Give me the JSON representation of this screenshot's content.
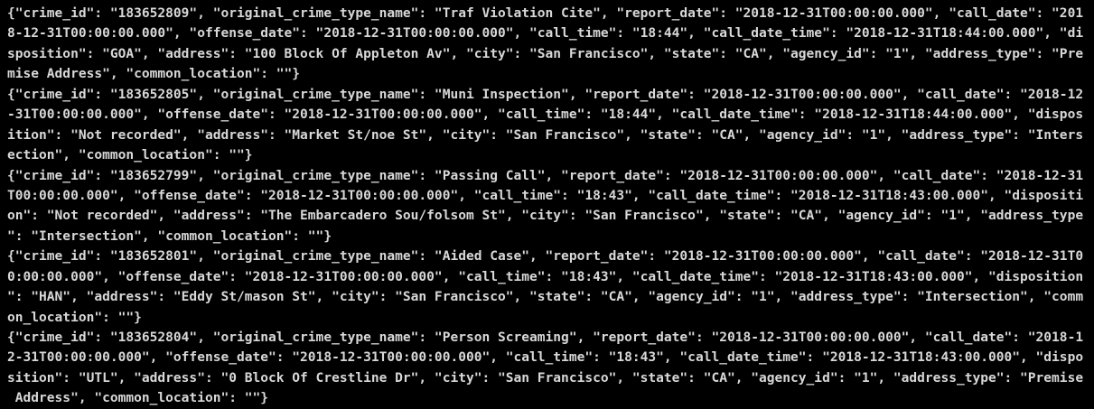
{
  "terminal": {
    "lines": [
      "{\"crime_id\": \"183652809\", \"original_crime_type_name\": \"Traf Violation Cite\", \"report_date\": \"2018-12-31T00:00:00.000\", \"call_date\": \"201",
      "8-12-31T00:00:00.000\", \"offense_date\": \"2018-12-31T00:00:00.000\", \"call_time\": \"18:44\", \"call_date_time\": \"2018-12-31T18:44:00.000\", \"di",
      "sposition\": \"GOA\", \"address\": \"100 Block Of Appleton Av\", \"city\": \"San Francisco\", \"state\": \"CA\", \"agency_id\": \"1\", \"address_type\": \"Pre",
      "mise Address\", \"common_location\": \"\"}",
      "{\"crime_id\": \"183652805\", \"original_crime_type_name\": \"Muni Inspection\", \"report_date\": \"2018-12-31T00:00:00.000\", \"call_date\": \"2018-12",
      "-31T00:00:00.000\", \"offense_date\": \"2018-12-31T00:00:00.000\", \"call_time\": \"18:44\", \"call_date_time\": \"2018-12-31T18:44:00.000\", \"dispos",
      "ition\": \"Not recorded\", \"address\": \"Market St/noe St\", \"city\": \"San Francisco\", \"state\": \"CA\", \"agency_id\": \"1\", \"address_type\": \"Inters",
      "ection\", \"common_location\": \"\"}",
      "{\"crime_id\": \"183652799\", \"original_crime_type_name\": \"Passing Call\", \"report_date\": \"2018-12-31T00:00:00.000\", \"call_date\": \"2018-12-31",
      "T00:00:00.000\", \"offense_date\": \"2018-12-31T00:00:00.000\", \"call_time\": \"18:43\", \"call_date_time\": \"2018-12-31T18:43:00.000\", \"dispositi",
      "on\": \"Not recorded\", \"address\": \"The Embarcadero Sou/folsom St\", \"city\": \"San Francisco\", \"state\": \"CA\", \"agency_id\": \"1\", \"address_type",
      "\": \"Intersection\", \"common_location\": \"\"}",
      "{\"crime_id\": \"183652801\", \"original_crime_type_name\": \"Aided Case\", \"report_date\": \"2018-12-31T00:00:00.000\", \"call_date\": \"2018-12-31T0",
      "0:00:00.000\", \"offense_date\": \"2018-12-31T00:00:00.000\", \"call_time\": \"18:43\", \"call_date_time\": \"2018-12-31T18:43:00.000\", \"disposition",
      "\": \"HAN\", \"address\": \"Eddy St/mason St\", \"city\": \"San Francisco\", \"state\": \"CA\", \"agency_id\": \"1\", \"address_type\": \"Intersection\", \"comm",
      "on_location\": \"\"}",
      "{\"crime_id\": \"183652804\", \"original_crime_type_name\": \"Person Screaming\", \"report_date\": \"2018-12-31T00:00:00.000\", \"call_date\": \"2018-1",
      "2-31T00:00:00.000\", \"offense_date\": \"2018-12-31T00:00:00.000\", \"call_time\": \"18:43\", \"call_date_time\": \"2018-12-31T18:43:00.000\", \"dispo",
      "sition\": \"UTL\", \"address\": \"0 Block Of Crestline Dr\", \"city\": \"San Francisco\", \"state\": \"CA\", \"agency_id\": \"1\", \"address_type\": \"Premise",
      " Address\", \"common_location\": \"\"}"
    ]
  },
  "colors": {
    "background": "#000000",
    "text": "#d8d8d8"
  }
}
